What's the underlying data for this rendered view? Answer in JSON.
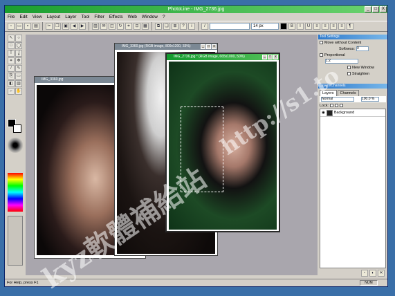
{
  "window": {
    "title": "PhotoLine - IMG_2736.jpg",
    "controls": [
      "_",
      "□",
      "X"
    ]
  },
  "menu": [
    "File",
    "Edit",
    "View",
    "Layout",
    "Layer",
    "Tool",
    "Filter",
    "Effects",
    "Web",
    "Window",
    "?"
  ],
  "toolbar": {
    "brush_size": "14 px",
    "font_combo": ""
  },
  "documents": [
    {
      "title": "IMG_3360.jpg"
    },
    {
      "title": "IMG_3360.jpg (RGB image, 800x1200, 33%)"
    },
    {
      "title": "IMG_2736.jpg * (RGB image, 665x1000, 50%)"
    }
  ],
  "tool_settings": {
    "title": "Tool Settings",
    "move_content": "Move without Content",
    "softness_label": "Softness:",
    "softness_value": "0",
    "proportional_label": "Proportional",
    "ratio": "1:2",
    "new_window": "New Window",
    "straighten": "Straighten"
  },
  "layers_panel": {
    "title": "Layers/Channels",
    "tabs": [
      "Layers",
      "Channels"
    ],
    "mode": "Normal",
    "opacity": "100.0 %",
    "lock_label": "Lock:",
    "layers": [
      {
        "name": "Background"
      }
    ]
  },
  "status": {
    "help": "For Help, press F1",
    "num": "NUM"
  },
  "watermark": {
    "line1": "kyz軟體補給站",
    "line2": "http://s1.to"
  }
}
